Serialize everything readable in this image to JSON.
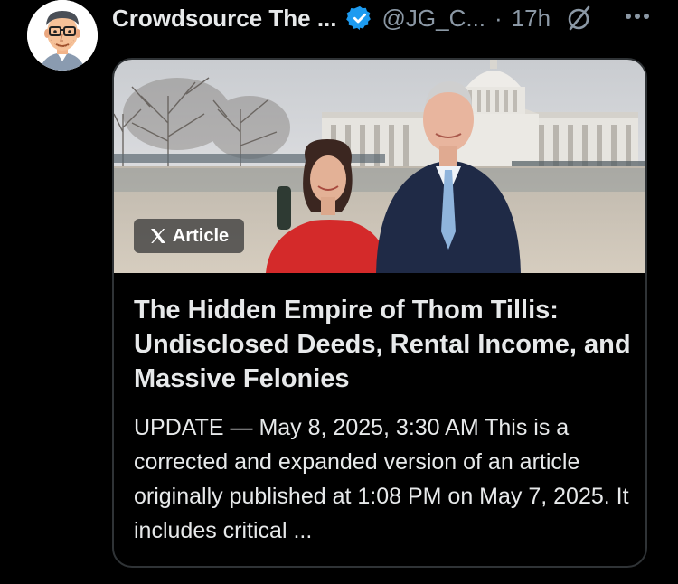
{
  "post": {
    "display_name": "Crowdsource The ...",
    "verified_icon": "verified-badge-icon",
    "handle": "@JG_C...",
    "separator": "·",
    "time": "17h",
    "grok_icon": "grok-icon",
    "more_icon": "more-dots-icon"
  },
  "article": {
    "badge_label": "Article",
    "badge_icon": "x-logo-icon",
    "title": "The Hidden Empire of Thom Tillis: Undisclosed Deeds, Rental Income, and Massive Felonies",
    "excerpt": "UPDATE — May 8, 2025, 3:30 AM This is a corrected and expanded version of an article originally published at 1:08 PM on May 7, 2025. It includes critical ..."
  },
  "colors": {
    "background": "#000000",
    "text_primary": "#e7e9ea",
    "text_secondary": "#8b98a5",
    "verified_blue": "#1d9bf0",
    "card_border": "#2f3336"
  }
}
